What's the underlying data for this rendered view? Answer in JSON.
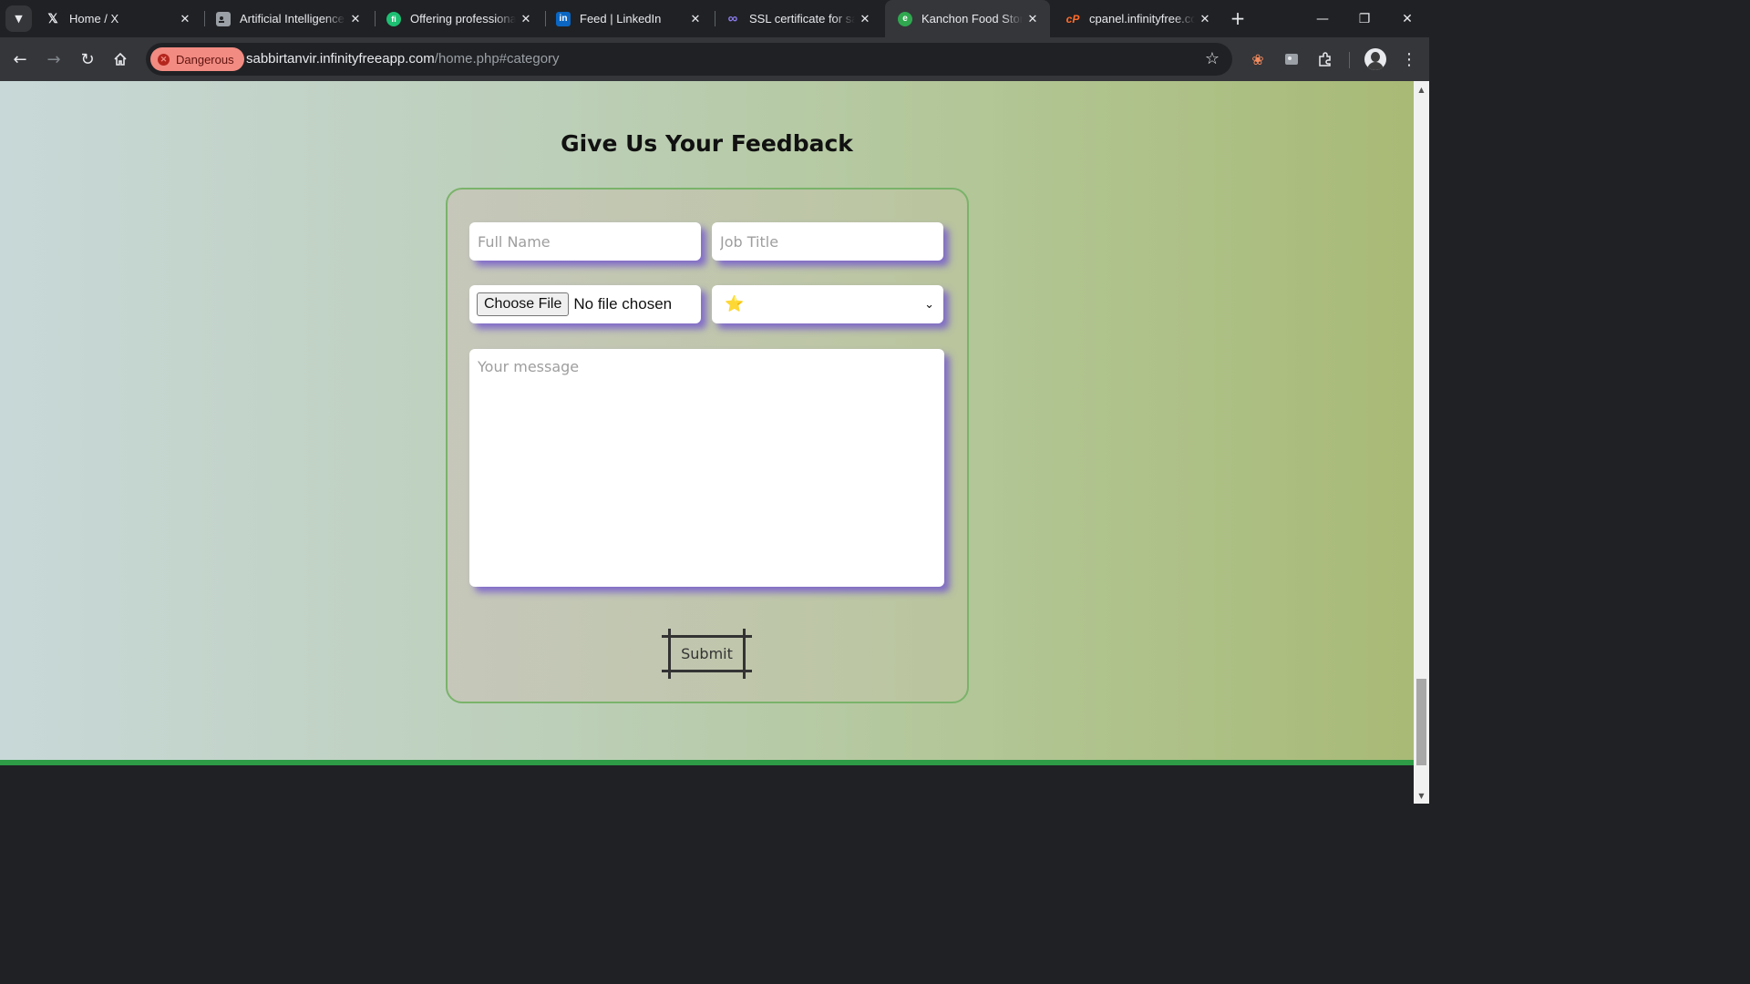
{
  "browser": {
    "tabs": [
      {
        "title": "Home / X",
        "favicon": "x-logo-icon",
        "active": false
      },
      {
        "title": "Artificial Intelligence",
        "favicon": "profile-card-icon",
        "active": false
      },
      {
        "title": "Offering professional",
        "favicon": "fiverr-icon",
        "active": false
      },
      {
        "title": "Feed | LinkedIn",
        "favicon": "linkedin-icon",
        "active": false
      },
      {
        "title": "SSL certificate for sal",
        "favicon": "infinity-icon",
        "active": false
      },
      {
        "title": "Kanchon Food Store",
        "favicon": "edge-e-icon",
        "active": true
      },
      {
        "title": "cpanel.infinityfree.co",
        "favicon": "cpanel-icon",
        "active": false
      }
    ],
    "security_chip": "Dangerous",
    "url_host": "sabbirtanvir.infinityfreeapp.com",
    "url_path": "/home.php#category"
  },
  "page": {
    "heading": "Give Us Your Feedback",
    "form": {
      "full_name_placeholder": "Full Name",
      "job_title_placeholder": "Job Title",
      "file_button_label": "Choose File",
      "file_status": "No file chosen",
      "rating_selected": "⭐",
      "message_placeholder": "Your message",
      "submit_label": "Submit"
    }
  },
  "colors": {
    "danger_chip_bg": "#f28b82",
    "field_shadow": "#765ccc",
    "card_border": "#7ab36a",
    "footer_line": "#2e9b47"
  }
}
